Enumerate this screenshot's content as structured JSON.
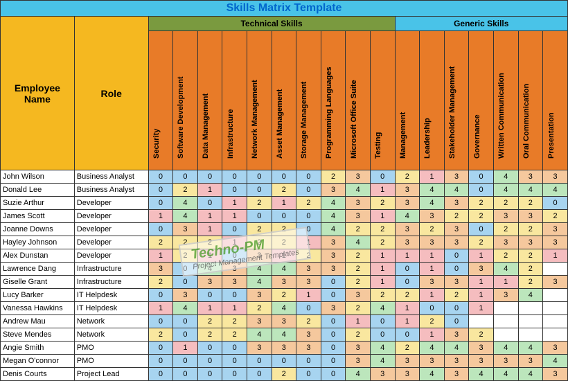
{
  "title": "Skills Matrix Template",
  "headers": {
    "employee": "Employee Name",
    "role": "Role",
    "techGroup": "Technical Skills",
    "genGroup": "Generic Skills"
  },
  "techSkills": [
    "Security",
    "Software Development",
    "Data Management",
    "Infrastructure",
    "Network Management",
    "Asset Management",
    "Storage Management",
    "Programming Languages",
    "Microsoft Office Suite",
    "Testing"
  ],
  "genSkills": [
    "Management",
    "Leadership",
    "Stakeholder Management",
    "Governance",
    "Written Communication",
    "Oral Communication",
    "Presentation"
  ],
  "rows": [
    {
      "name": "John Wilson",
      "role": "Business Analyst",
      "scores": [
        0,
        0,
        0,
        0,
        0,
        0,
        0,
        2,
        3,
        0,
        2,
        1,
        3,
        0,
        4,
        3,
        3
      ]
    },
    {
      "name": "Donald Lee",
      "role": "Business Analyst",
      "scores": [
        0,
        2,
        1,
        0,
        0,
        2,
        0,
        3,
        4,
        1,
        3,
        4,
        4,
        0,
        4,
        4,
        4
      ]
    },
    {
      "name": "Suzie Arthur",
      "role": "Developer",
      "scores": [
        0,
        4,
        0,
        1,
        2,
        1,
        2,
        4,
        3,
        2,
        3,
        4,
        3,
        2,
        2,
        2,
        0
      ]
    },
    {
      "name": "James Scott",
      "role": "Developer",
      "scores": [
        1,
        4,
        1,
        1,
        0,
        0,
        0,
        4,
        3,
        1,
        4,
        3,
        2,
        2,
        3,
        3,
        2
      ]
    },
    {
      "name": "Joanne Downs",
      "role": "Developer",
      "scores": [
        0,
        3,
        1,
        0,
        2,
        2,
        0,
        4,
        2,
        2,
        3,
        2,
        3,
        0,
        2,
        2,
        3
      ]
    },
    {
      "name": "Hayley Johnson",
      "role": "Developer",
      "scores": [
        2,
        2,
        2,
        1,
        2,
        2,
        1,
        3,
        4,
        2,
        3,
        3,
        3,
        2,
        3,
        3,
        3
      ]
    },
    {
      "name": "Alex Dunstan",
      "role": "Developer",
      "scores": [
        1,
        2,
        1,
        0,
        3,
        1,
        2,
        3,
        2,
        1,
        1,
        1,
        0,
        1,
        2,
        2,
        1
      ]
    },
    {
      "name": "Lawrence Dang",
      "role": "Infrastructure",
      "scores": [
        3,
        0,
        4,
        3,
        4,
        4,
        3,
        3,
        2,
        1,
        0,
        1,
        0,
        3,
        4,
        2
      ]
    },
    {
      "name": "Giselle Grant",
      "role": "Infrastructure",
      "scores": [
        2,
        0,
        3,
        3,
        4,
        3,
        3,
        0,
        2,
        1,
        0,
        3,
        3,
        1,
        1,
        2,
        3
      ]
    },
    {
      "name": "Lucy Barker",
      "role": "IT Helpdesk",
      "scores": [
        0,
        3,
        0,
        0,
        3,
        2,
        1,
        0,
        3,
        2,
        2,
        1,
        2,
        1,
        3,
        4
      ]
    },
    {
      "name": "Vanessa Hawkins",
      "role": "IT Helpdesk",
      "scores": [
        1,
        4,
        1,
        1,
        2,
        4,
        0,
        3,
        2,
        4,
        1,
        0,
        0,
        1
      ]
    },
    {
      "name": "Andrew Mau",
      "role": "Network",
      "scores": [
        0,
        0,
        2,
        2,
        3,
        3,
        2,
        0,
        1,
        0,
        1,
        2,
        0
      ]
    },
    {
      "name": "Steve Mendes",
      "role": "Network",
      "scores": [
        2,
        0,
        2,
        2,
        4,
        4,
        3,
        0,
        2,
        0,
        0,
        1,
        3,
        2
      ]
    },
    {
      "name": "Angie Smith",
      "role": "PMO",
      "scores": [
        0,
        1,
        0,
        0,
        3,
        3,
        3,
        0,
        3,
        4,
        2,
        4,
        4,
        3,
        4,
        4,
        3
      ]
    },
    {
      "name": "Megan O'connor",
      "role": "PMO",
      "scores": [
        0,
        0,
        0,
        0,
        0,
        0,
        0,
        0,
        3,
        4,
        3,
        3,
        3,
        3,
        3,
        3,
        4
      ]
    },
    {
      "name": "Denis Courts",
      "role": "Project Lead",
      "scores": [
        0,
        0,
        0,
        0,
        0,
        2,
        0,
        0,
        4,
        3,
        3,
        4,
        3,
        4,
        4,
        4,
        3
      ]
    }
  ],
  "watermark": {
    "title": "Techno-PM",
    "sub": "Project Management Templates"
  }
}
